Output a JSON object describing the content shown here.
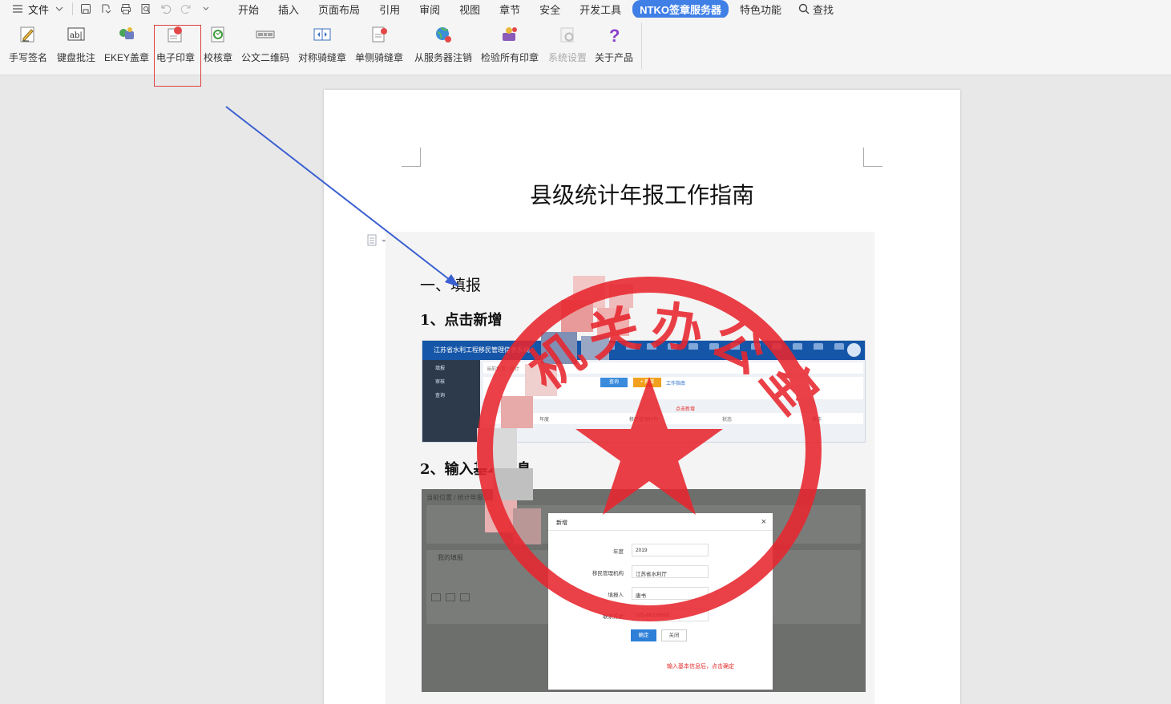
{
  "menu": {
    "file_label": "文件",
    "tabs": [
      {
        "label": "开始"
      },
      {
        "label": "插入"
      },
      {
        "label": "页面布局"
      },
      {
        "label": "引用"
      },
      {
        "label": "审阅"
      },
      {
        "label": "视图"
      },
      {
        "label": "章节"
      },
      {
        "label": "安全"
      },
      {
        "label": "开发工具"
      },
      {
        "label": "NTKO签章服务器"
      },
      {
        "label": "特色功能"
      }
    ],
    "active_tab": "NTKO签章服务器",
    "search_label": "查找",
    "accent_color": "#3f7fe6"
  },
  "ribbon": {
    "buttons": [
      {
        "label": "手写签名",
        "icon": "pen-signature-icon"
      },
      {
        "label": "键盘批注",
        "icon": "keyboard-annotate-icon"
      },
      {
        "label": "EKEY盖章",
        "icon": "ekey-stamp-icon"
      },
      {
        "label": "电子印章",
        "icon": "electronic-seal-icon"
      },
      {
        "label": "校核章",
        "icon": "verify-seal-icon"
      },
      {
        "label": "公文二维码",
        "icon": "qr-code-icon"
      },
      {
        "label": "对称骑缝章",
        "icon": "symmetric-seam-seal-icon"
      },
      {
        "label": "单侧骑缝章",
        "icon": "single-seam-seal-icon"
      },
      {
        "label": "从服务器注销",
        "icon": "server-logout-icon"
      },
      {
        "label": "检验所有印章",
        "icon": "verify-all-seals-icon"
      },
      {
        "label": "系统设置",
        "icon": "system-settings-icon",
        "disabled": true
      },
      {
        "label": "关于产品",
        "icon": "help-icon"
      }
    ],
    "highlighted_button": "电子印章"
  },
  "document": {
    "title": "县级统计年报工作指南",
    "section1": "一、填报",
    "step1": "1、点击新增",
    "step2": "2、输入基本信息",
    "shot1": {
      "app_title": "江苏省水利工程移民管理信息系统",
      "side_items": [
        "填报",
        "审核",
        "查询"
      ],
      "crumb": "当前位置 / 统计",
      "btn_search": "查询",
      "btn_add": "+ 新增",
      "link_guide": "工作指南",
      "hint": "点击新增",
      "col_year": "年度",
      "col_org": "移民管理机构",
      "col_status": "状态",
      "col_action": "操作"
    },
    "shot2": {
      "crumb": "当前位置 / 统计年报",
      "tab_label": "我的填报",
      "modal_title": "新增",
      "fields": [
        {
          "label": "年度",
          "value": "2019"
        },
        {
          "label": "移民管理机构",
          "value": "江苏省水利厅"
        },
        {
          "label": "填报人",
          "value": "唐书"
        },
        {
          "label": "联系方式",
          "value": "025-86339658"
        }
      ],
      "btn_ok": "确定",
      "btn_close": "关闭",
      "hint": "输入基本信息后，点击确定"
    },
    "seal_text": "机关办公室",
    "seal_color": "#e8262e"
  }
}
